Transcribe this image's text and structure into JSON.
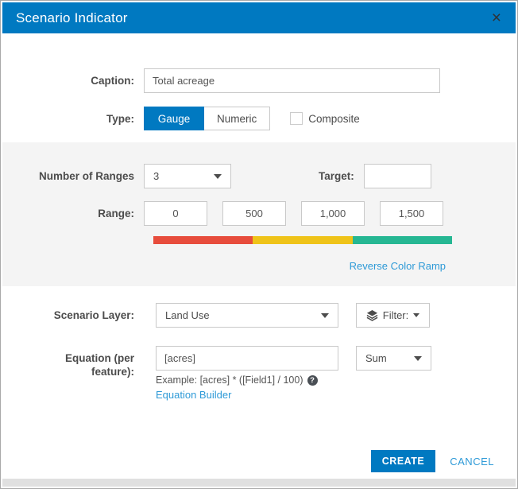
{
  "dialog": {
    "title": "Scenario Indicator",
    "close_glyph": "×"
  },
  "form": {
    "caption": {
      "label": "Caption:",
      "value": "Total acreage"
    },
    "type": {
      "label": "Type:",
      "options": [
        "Gauge",
        "Numeric"
      ],
      "selected": "Gauge",
      "composite_label": "Composite",
      "composite_checked": false
    },
    "ranges": {
      "number_label": "Number of Ranges",
      "number_value": "3",
      "target_label": "Target:",
      "target_value": "",
      "range_label": "Range:",
      "range_values": [
        "0",
        "500",
        "1,000",
        "1,500"
      ],
      "ramp_colors": [
        "#e74c3c",
        "#efc319",
        "#26b793"
      ],
      "reverse_link": "Reverse Color Ramp"
    },
    "layer": {
      "label": "Scenario Layer:",
      "value": "Land Use",
      "filter_label": "Filter:"
    },
    "equation": {
      "label_line1": "Equation (per",
      "label_line2": "feature):",
      "value": "[acres]",
      "aggregation_value": "Sum",
      "example": "Example: [acres] * ([Field1] / 100)",
      "help_glyph": "?",
      "builder_link": "Equation Builder"
    }
  },
  "footer": {
    "create_label": "CREATE",
    "cancel_label": "CANCEL"
  },
  "colors": {
    "accent": "#0079c1",
    "link": "#2e9ad7",
    "ramp_red": "#e74c3c",
    "ramp_yellow": "#efc319",
    "ramp_green": "#26b793"
  }
}
